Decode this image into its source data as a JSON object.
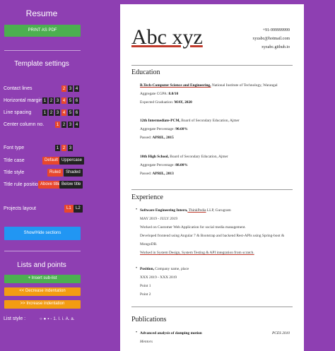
{
  "sidebar": {
    "title": "Resume",
    "print_label": "PRINT AS PDF",
    "template_settings_title": "Template settings",
    "contact_lines": {
      "label": "Contact lines",
      "options": [
        "2",
        "3",
        "4"
      ],
      "selected": "2"
    },
    "horizontal_margin": {
      "label": "Horizontal margin",
      "options": [
        "1",
        "2",
        "3",
        "4",
        "5",
        "6"
      ],
      "selected": "4"
    },
    "line_spacing": {
      "label": "Line spacing",
      "options": [
        "1",
        "2",
        "3",
        "4",
        "5",
        "6"
      ],
      "selected": "4"
    },
    "center_column": {
      "label": "Center column no.",
      "options": [
        "1",
        "2",
        "3",
        "4"
      ],
      "selected": "1"
    },
    "font_type": {
      "label": "Font type",
      "options": [
        "1",
        "2",
        "3"
      ],
      "selected": "2"
    },
    "title_case": {
      "label": "Title case",
      "options": [
        "Default",
        "Uppercase"
      ],
      "selected": "Default"
    },
    "title_style": {
      "label": "Title style",
      "options": [
        "Ruled",
        "Shaded"
      ],
      "selected": "Ruled"
    },
    "title_rule_position": {
      "label": "Title rule position",
      "options": [
        "Above title",
        "Below title"
      ],
      "selected": "Above title"
    },
    "projects_layout": {
      "label": "Projects layout",
      "options": [
        "L1",
        "L2"
      ],
      "selected": "L1"
    },
    "show_hide_label": "Show/Hide sections",
    "lists_title": "Lists and points",
    "insert_sublist_label": "+ Insert sub-list",
    "decrease_indent_label": "<< Decrease indentation",
    "increase_indent_label": ">> Increase indentation",
    "list_style_label": "List style :",
    "list_style_options": [
      "○",
      "●",
      "▪",
      "-",
      "1.",
      "I.",
      "i.",
      "A.",
      "a."
    ],
    "colors": {
      "green": "#4caf50",
      "blue": "#2196f3",
      "orange": "#f39c12",
      "red": "#e8472c",
      "dark": "#222222"
    }
  },
  "resume": {
    "name": "Abc xyz",
    "contact": [
      "+91-999999999",
      "xyzabc@hotmail.com",
      "xyzabc.github.io"
    ],
    "education": {
      "title": "Education",
      "btech": {
        "degree": "B.Tech-Computer Science and Engineering,",
        "school": " National Institute of Technology, Warangal",
        "cgpa_label": "Aggregate CGPA: ",
        "cgpa": "8.0/10",
        "grad_label": "Expected Graduation: ",
        "grad": "MAY, 2020"
      },
      "inter": {
        "degree": "12th Intermediate-PCM,",
        "school": " Board of Secondary Education, Ajmer",
        "pct_label": "Aggregate Percentage: ",
        "pct": "90.60%",
        "passed_label": "Passed: ",
        "passed": "APRIL, 2015"
      },
      "school": {
        "degree": "10th High School,",
        "school": " Board of Secondary Education, Ajmer",
        "pct_label": "Aggregate Percentage: ",
        "pct": "88.00%",
        "passed_label": "Passed: ",
        "passed": "APRIL, 2013"
      }
    },
    "experience": {
      "title": "Experience",
      "job1": {
        "bullet": "•",
        "title": "Software Engineering Intern,",
        "company": " ThinkPedia",
        "loc": " LLP, Gurugram",
        "dates": "MAY 2019 - JULY 2019",
        "lines": [
          "Worked on Customer Web Application for social media management.",
          "Developed frontend using Angular 7 & Bootstrap and backend Rest-APIs using Spring-boot &",
          "MongoDB.",
          "Worked in System Design, System Testing & API integration from scratch."
        ]
      },
      "job2": {
        "bullet": "•",
        "title": "Position,",
        "rest": " Company name, place",
        "dates": "XXX 2019 - XXX 2019",
        "lines": [
          "Point 1",
          "Point 2"
        ]
      }
    },
    "publications": {
      "title": "Publications",
      "bullet": "•",
      "item": "Advanced analysis of damping motion",
      "venue": "PCES 2010",
      "sub": "Mentors"
    }
  }
}
